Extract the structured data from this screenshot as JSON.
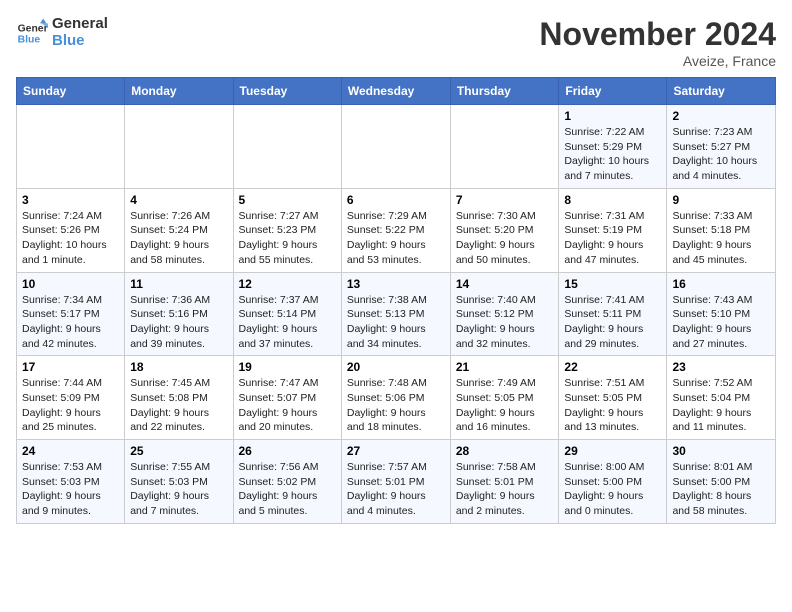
{
  "header": {
    "logo_line1": "General",
    "logo_line2": "Blue",
    "month": "November 2024",
    "location": "Aveize, France"
  },
  "weekdays": [
    "Sunday",
    "Monday",
    "Tuesday",
    "Wednesday",
    "Thursday",
    "Friday",
    "Saturday"
  ],
  "weeks": [
    [
      {
        "day": "",
        "info": ""
      },
      {
        "day": "",
        "info": ""
      },
      {
        "day": "",
        "info": ""
      },
      {
        "day": "",
        "info": ""
      },
      {
        "day": "",
        "info": ""
      },
      {
        "day": "1",
        "info": "Sunrise: 7:22 AM\nSunset: 5:29 PM\nDaylight: 10 hours and 7 minutes."
      },
      {
        "day": "2",
        "info": "Sunrise: 7:23 AM\nSunset: 5:27 PM\nDaylight: 10 hours and 4 minutes."
      }
    ],
    [
      {
        "day": "3",
        "info": "Sunrise: 7:24 AM\nSunset: 5:26 PM\nDaylight: 10 hours and 1 minute."
      },
      {
        "day": "4",
        "info": "Sunrise: 7:26 AM\nSunset: 5:24 PM\nDaylight: 9 hours and 58 minutes."
      },
      {
        "day": "5",
        "info": "Sunrise: 7:27 AM\nSunset: 5:23 PM\nDaylight: 9 hours and 55 minutes."
      },
      {
        "day": "6",
        "info": "Sunrise: 7:29 AM\nSunset: 5:22 PM\nDaylight: 9 hours and 53 minutes."
      },
      {
        "day": "7",
        "info": "Sunrise: 7:30 AM\nSunset: 5:20 PM\nDaylight: 9 hours and 50 minutes."
      },
      {
        "day": "8",
        "info": "Sunrise: 7:31 AM\nSunset: 5:19 PM\nDaylight: 9 hours and 47 minutes."
      },
      {
        "day": "9",
        "info": "Sunrise: 7:33 AM\nSunset: 5:18 PM\nDaylight: 9 hours and 45 minutes."
      }
    ],
    [
      {
        "day": "10",
        "info": "Sunrise: 7:34 AM\nSunset: 5:17 PM\nDaylight: 9 hours and 42 minutes."
      },
      {
        "day": "11",
        "info": "Sunrise: 7:36 AM\nSunset: 5:16 PM\nDaylight: 9 hours and 39 minutes."
      },
      {
        "day": "12",
        "info": "Sunrise: 7:37 AM\nSunset: 5:14 PM\nDaylight: 9 hours and 37 minutes."
      },
      {
        "day": "13",
        "info": "Sunrise: 7:38 AM\nSunset: 5:13 PM\nDaylight: 9 hours and 34 minutes."
      },
      {
        "day": "14",
        "info": "Sunrise: 7:40 AM\nSunset: 5:12 PM\nDaylight: 9 hours and 32 minutes."
      },
      {
        "day": "15",
        "info": "Sunrise: 7:41 AM\nSunset: 5:11 PM\nDaylight: 9 hours and 29 minutes."
      },
      {
        "day": "16",
        "info": "Sunrise: 7:43 AM\nSunset: 5:10 PM\nDaylight: 9 hours and 27 minutes."
      }
    ],
    [
      {
        "day": "17",
        "info": "Sunrise: 7:44 AM\nSunset: 5:09 PM\nDaylight: 9 hours and 25 minutes."
      },
      {
        "day": "18",
        "info": "Sunrise: 7:45 AM\nSunset: 5:08 PM\nDaylight: 9 hours and 22 minutes."
      },
      {
        "day": "19",
        "info": "Sunrise: 7:47 AM\nSunset: 5:07 PM\nDaylight: 9 hours and 20 minutes."
      },
      {
        "day": "20",
        "info": "Sunrise: 7:48 AM\nSunset: 5:06 PM\nDaylight: 9 hours and 18 minutes."
      },
      {
        "day": "21",
        "info": "Sunrise: 7:49 AM\nSunset: 5:05 PM\nDaylight: 9 hours and 16 minutes."
      },
      {
        "day": "22",
        "info": "Sunrise: 7:51 AM\nSunset: 5:05 PM\nDaylight: 9 hours and 13 minutes."
      },
      {
        "day": "23",
        "info": "Sunrise: 7:52 AM\nSunset: 5:04 PM\nDaylight: 9 hours and 11 minutes."
      }
    ],
    [
      {
        "day": "24",
        "info": "Sunrise: 7:53 AM\nSunset: 5:03 PM\nDaylight: 9 hours and 9 minutes."
      },
      {
        "day": "25",
        "info": "Sunrise: 7:55 AM\nSunset: 5:03 PM\nDaylight: 9 hours and 7 minutes."
      },
      {
        "day": "26",
        "info": "Sunrise: 7:56 AM\nSunset: 5:02 PM\nDaylight: 9 hours and 5 minutes."
      },
      {
        "day": "27",
        "info": "Sunrise: 7:57 AM\nSunset: 5:01 PM\nDaylight: 9 hours and 4 minutes."
      },
      {
        "day": "28",
        "info": "Sunrise: 7:58 AM\nSunset: 5:01 PM\nDaylight: 9 hours and 2 minutes."
      },
      {
        "day": "29",
        "info": "Sunrise: 8:00 AM\nSunset: 5:00 PM\nDaylight: 9 hours and 0 minutes."
      },
      {
        "day": "30",
        "info": "Sunrise: 8:01 AM\nSunset: 5:00 PM\nDaylight: 8 hours and 58 minutes."
      }
    ]
  ]
}
